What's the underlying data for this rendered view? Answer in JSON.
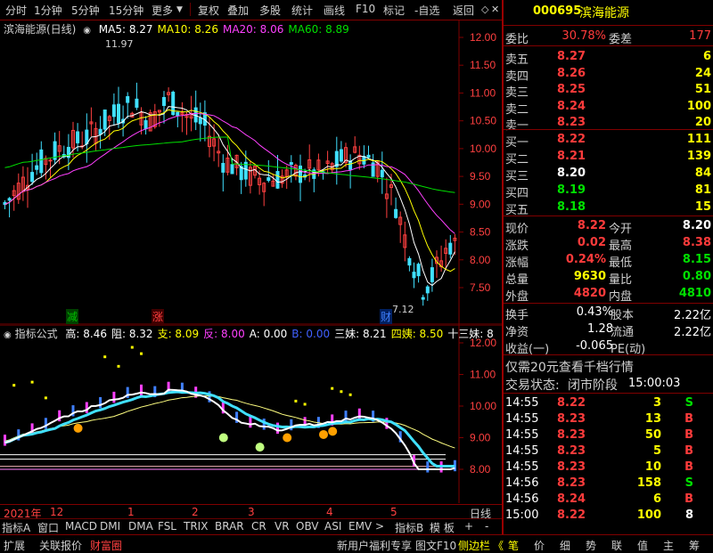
{
  "toolbar": {
    "items": [
      "分时",
      "1分钟",
      "5分钟",
      "15分钟",
      "更多",
      "复权",
      "叠加",
      "多股",
      "统计",
      "画线",
      "F10",
      "标记",
      "-自选",
      "返回"
    ]
  },
  "main_chart": {
    "title": "滨海能源(日线)",
    "ma": [
      {
        "label": "MA5: 8.27",
        "color": "#ffffff"
      },
      {
        "label": "MA10: 8.26",
        "color": "#ffff00"
      },
      {
        "label": "MA20: 8.06",
        "color": "#ff40ff"
      },
      {
        "label": "MA60: 8.89",
        "color": "#00e000"
      }
    ],
    "y_ticks": [
      "12.00",
      "11.50",
      "11.00",
      "10.50",
      "10.00",
      "9.50",
      "9.00",
      "8.50",
      "8.00",
      "7.50"
    ],
    "high_label": "11.97",
    "low_label": "7.12",
    "markers": [
      {
        "text": "减",
        "color": "#00c000"
      },
      {
        "text": "涨",
        "color": "#ff4040"
      },
      {
        "text": "财",
        "color": "#4080ff"
      }
    ]
  },
  "sub_chart": {
    "formula_label": "指标公式",
    "indicators": [
      {
        "label": "高: 8.46",
        "color": "#ffffff"
      },
      {
        "label": "阻: 8.32",
        "color": "#ffffff"
      },
      {
        "label": "支: 8.09",
        "color": "#ffff00"
      },
      {
        "label": "反: 8.00",
        "color": "#ff40ff"
      },
      {
        "label": "A: 0.00",
        "color": "#ffffff"
      },
      {
        "label": "B: 0.00",
        "color": "#4060ff"
      },
      {
        "label": "三妹: 8.21",
        "color": "#ffffff"
      },
      {
        "label": "四姨: 8.50",
        "color": "#ffff00"
      },
      {
        "label": "十三妹: 8",
        "color": "#ffffff"
      }
    ],
    "y_ticks": [
      "12.00",
      "11.00",
      "10.00",
      "9.00",
      "8.00"
    ]
  },
  "x_axis": {
    "labels": [
      "2021年",
      "12",
      "1",
      "2",
      "3",
      "4",
      "5"
    ],
    "right_label": "日线"
  },
  "bottom_tabs": [
    "指标A",
    "窗口",
    "MACD",
    "DMI",
    "DMA",
    "FSL",
    "TRIX",
    "BRAR",
    "CR",
    "VR",
    "OBV",
    "ASI",
    "EMV"
  ],
  "bottom_tabs_right": [
    "指标B",
    "模 板",
    "+",
    "-"
  ],
  "status_bar": {
    "left": [
      "扩展",
      "关联报价",
      "财富圈"
    ],
    "right_text": [
      "新用户福利专享",
      "图文F10",
      "侧边栏"
    ],
    "icons": [
      "笔",
      "价",
      "细",
      "势",
      "联",
      "值",
      "主",
      "筹"
    ]
  },
  "quote": {
    "code": "000695",
    "name": "滨海能源",
    "wb_label": "委比",
    "wb_value": "30.78%",
    "wc_label": "委差",
    "wc_value": "177",
    "sell": [
      {
        "label": "卖五",
        "price": "8.27",
        "vol": "6"
      },
      {
        "label": "卖四",
        "price": "8.26",
        "vol": "24"
      },
      {
        "label": "卖三",
        "price": "8.25",
        "vol": "51"
      },
      {
        "label": "卖二",
        "price": "8.24",
        "vol": "100"
      },
      {
        "label": "卖一",
        "price": "8.23",
        "vol": "20"
      }
    ],
    "buy": [
      {
        "label": "买一",
        "price": "8.22",
        "vol": "111"
      },
      {
        "label": "买二",
        "price": "8.21",
        "vol": "139"
      },
      {
        "label": "买三",
        "price": "8.20",
        "vol": "84"
      },
      {
        "label": "买四",
        "price": "8.19",
        "vol": "81"
      },
      {
        "label": "买五",
        "price": "8.18",
        "vol": "15"
      }
    ],
    "stats": [
      {
        "l1": "现价",
        "v1": "8.22",
        "c1": "red",
        "l2": "今开",
        "v2": "8.20",
        "c2": "white"
      },
      {
        "l1": "涨跌",
        "v1": "0.02",
        "c1": "red",
        "l2": "最高",
        "v2": "8.38",
        "c2": "red"
      },
      {
        "l1": "涨幅",
        "v1": "0.24%",
        "c1": "red",
        "l2": "最低",
        "v2": "8.15",
        "c2": "green"
      },
      {
        "l1": "总量",
        "v1": "9630",
        "c1": "yellow",
        "l2": "量比",
        "v2": "0.80",
        "c2": "green"
      },
      {
        "l1": "外盘",
        "v1": "4820",
        "c1": "red",
        "l2": "内盘",
        "v2": "4810",
        "c2": "green"
      }
    ],
    "stats2": [
      {
        "l1": "换手",
        "v1": "0.43%",
        "l2": "股本",
        "v2": "2.22亿"
      },
      {
        "l1": "净资",
        "v1": "1.28",
        "l2": "流通",
        "v2": "2.22亿"
      },
      {
        "l1": "收益(一)",
        "v1": "-0.065",
        "l2": "PE(动)",
        "v2": ""
      }
    ],
    "promo": "仅需20元查看千档行情",
    "trade_status_label": "交易状态:",
    "trade_status": "闭市阶段",
    "trade_time": "15:00:03",
    "ticks": [
      {
        "t": "14:55",
        "p": "8.22",
        "v": "3",
        "bs": "S"
      },
      {
        "t": "14:55",
        "p": "8.23",
        "v": "13",
        "bs": "B"
      },
      {
        "t": "14:55",
        "p": "8.23",
        "v": "50",
        "bs": "B"
      },
      {
        "t": "14:55",
        "p": "8.23",
        "v": "5",
        "bs": "B"
      },
      {
        "t": "14:55",
        "p": "8.23",
        "v": "10",
        "bs": "B"
      },
      {
        "t": "14:56",
        "p": "8.23",
        "v": "158",
        "bs": "S"
      },
      {
        "t": "14:56",
        "p": "8.24",
        "v": "6",
        "bs": "B"
      },
      {
        "t": "15:00",
        "p": "8.22",
        "v": "100",
        "bs": "8"
      }
    ]
  }
}
